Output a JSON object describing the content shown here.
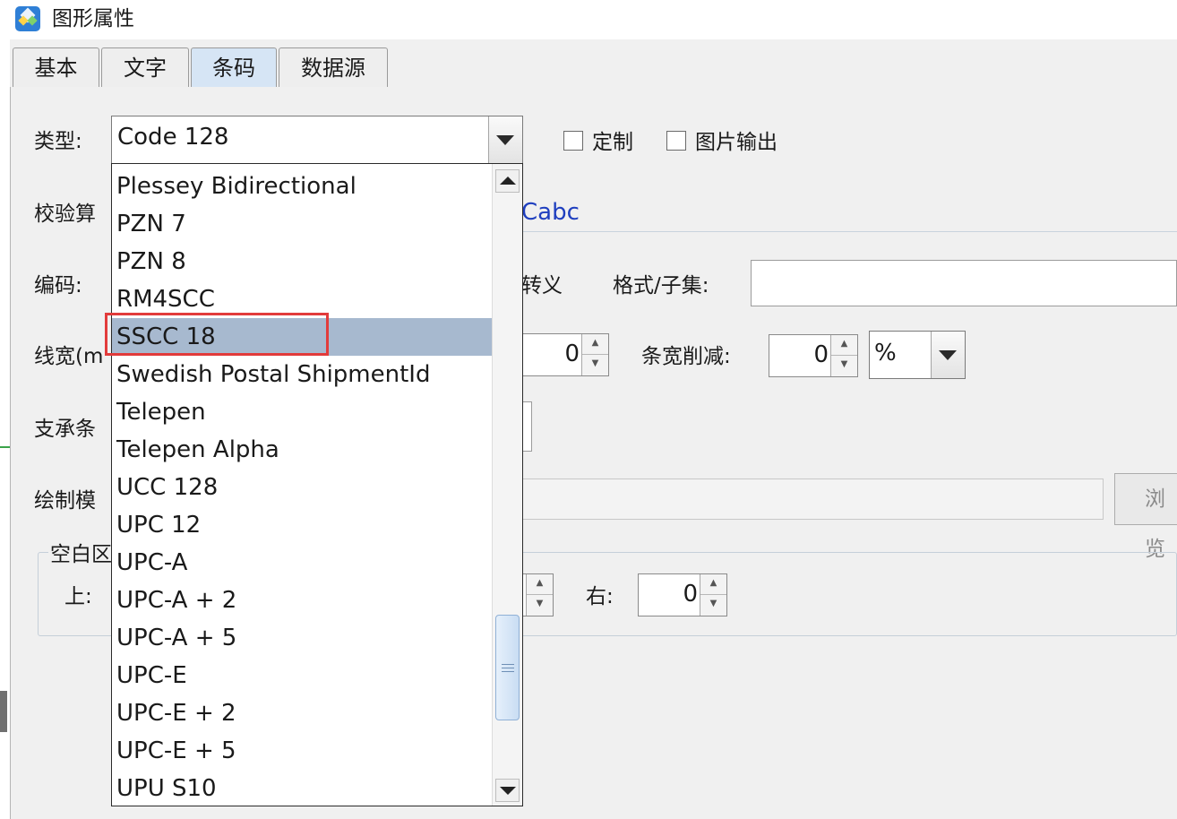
{
  "window": {
    "title": "图形属性",
    "app_icon": "barcode-app-icon"
  },
  "tabs": [
    {
      "label": "基本",
      "active": false
    },
    {
      "label": "文字",
      "active": false
    },
    {
      "label": "条码",
      "active": true
    },
    {
      "label": "数据源",
      "active": false
    }
  ],
  "form": {
    "type_label": "类型:",
    "type_value": "Code 128",
    "custom_label": "定制",
    "image_output_label": "图片输出",
    "checksum_label": "校验算",
    "checksum_value_fragment": "Cabc",
    "encoding_label": "编码:",
    "escape_label": "转义",
    "format_subset_label": "格式/子集:",
    "line_width_label": "线宽(m",
    "line_width_value": "0",
    "bar_reduction_label": "条宽削减:",
    "bar_reduction_value": "0",
    "bar_reduction_unit": "%",
    "bearer_label": "支承条",
    "draw_mode_label": "绘制模",
    "browse_button": "浏览",
    "quiet_zone_label": "空白区",
    "top_label": "上:",
    "right_label": "右:",
    "right_value": "0"
  },
  "dropdown": {
    "items": [
      "Plessey Bidirectional",
      "PZN 7",
      "PZN 8",
      "RM4SCC",
      "SSCC 18",
      "Swedish Postal ShipmentId",
      "Telepen",
      "Telepen Alpha",
      "UCC 128",
      "UPC 12",
      "UPC-A",
      "UPC-A + 2",
      "UPC-A + 5",
      "UPC-E",
      "UPC-E + 2",
      "UPC-E + 5",
      "UPU S10"
    ],
    "selected": "SSCC 18"
  },
  "colors": {
    "accent_highlight": "#e23b3b",
    "selection": "#a7b9cf",
    "link_blue": "#1f3fbf"
  }
}
